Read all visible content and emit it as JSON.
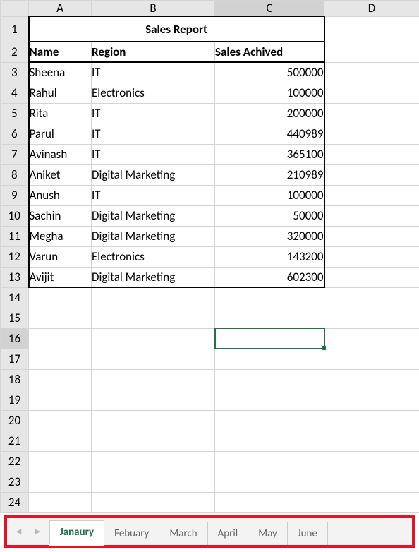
{
  "columns": [
    "A",
    "B",
    "C",
    "D"
  ],
  "title": "Sales Report",
  "headers": {
    "name": "Name",
    "region": "Region",
    "sales": "Sales Achived"
  },
  "rows": [
    {
      "name": "Sheena",
      "region": "IT",
      "sales": "500000"
    },
    {
      "name": "Rahul",
      "region": "Electronics",
      "sales": "100000"
    },
    {
      "name": "Rita",
      "region": "IT",
      "sales": "200000"
    },
    {
      "name": "Parul",
      "region": "IT",
      "sales": "440989"
    },
    {
      "name": "Avinash",
      "region": "IT",
      "sales": "365100"
    },
    {
      "name": "Aniket",
      "region": "Digital Marketing",
      "sales": "210989"
    },
    {
      "name": "Anush",
      "region": "IT",
      "sales": "100000"
    },
    {
      "name": "Sachin",
      "region": "Digital Marketing",
      "sales": "50000"
    },
    {
      "name": "Megha",
      "region": "Digital Marketing",
      "sales": "320000"
    },
    {
      "name": "Varun",
      "region": "Electronics",
      "sales": "143200"
    },
    {
      "name": "Avijit",
      "region": "Digital Marketing",
      "sales": "602300"
    }
  ],
  "row_numbers": [
    "1",
    "2",
    "3",
    "4",
    "5",
    "6",
    "7",
    "8",
    "9",
    "10",
    "11",
    "12",
    "13",
    "14",
    "15",
    "16",
    "17",
    "18",
    "19",
    "20",
    "21",
    "22",
    "23",
    "24"
  ],
  "tabs": [
    "Janaury",
    "Febuary",
    "March",
    "April",
    "May",
    "June"
  ],
  "active_tab_index": 0,
  "selected_cell": "C16",
  "chart_data": {
    "type": "table",
    "title": "Sales Report",
    "columns": [
      "Name",
      "Region",
      "Sales Achived"
    ],
    "rows": [
      [
        "Sheena",
        "IT",
        500000
      ],
      [
        "Rahul",
        "Electronics",
        100000
      ],
      [
        "Rita",
        "IT",
        200000
      ],
      [
        "Parul",
        "IT",
        440989
      ],
      [
        "Avinash",
        "IT",
        365100
      ],
      [
        "Aniket",
        "Digital Marketing",
        210989
      ],
      [
        "Anush",
        "IT",
        100000
      ],
      [
        "Sachin",
        "Digital Marketing",
        50000
      ],
      [
        "Megha",
        "Digital Marketing",
        320000
      ],
      [
        "Varun",
        "Electronics",
        143200
      ],
      [
        "Avijit",
        "Digital Marketing",
        602300
      ]
    ]
  }
}
